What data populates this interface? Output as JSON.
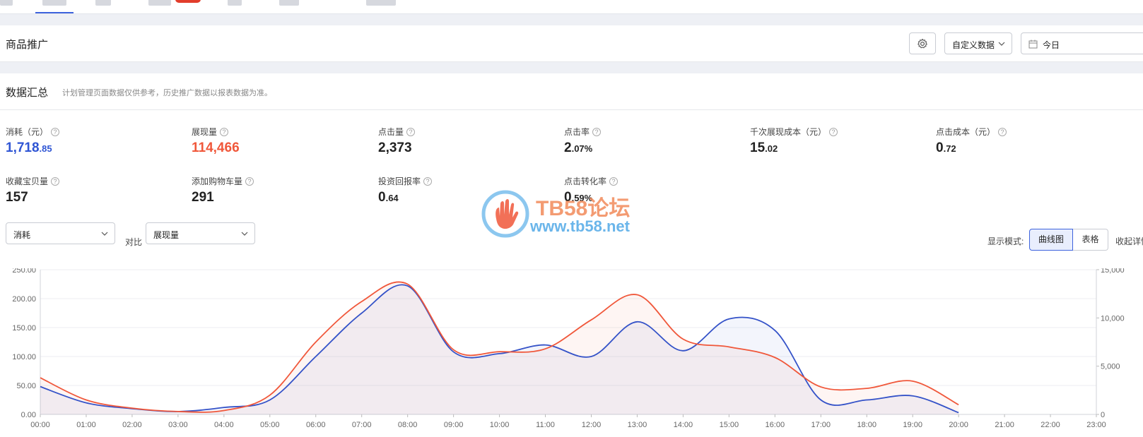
{
  "page": {
    "panel_title": "商品推广",
    "custom_data_label": "自定义数据",
    "date_value": "今日"
  },
  "summary": {
    "title": "数据汇总",
    "note": "计划管理页面数据仅供参考，历史推广数据以报表数据为准。",
    "metrics": [
      {
        "label": "消耗（元）",
        "int": "1,718",
        "dec": ".85",
        "color": "#2f55d4"
      },
      {
        "label": "展现量",
        "int": "114,466",
        "dec": "",
        "color": "#f0573a"
      },
      {
        "label": "点击量",
        "int": "2,373",
        "dec": "",
        "color": "#222222"
      },
      {
        "label": "点击率",
        "int": "2",
        "dec": ".07%",
        "color": "#222222"
      },
      {
        "label": "千次展现成本（元）",
        "int": "15",
        "dec": ".02",
        "color": "#222222"
      },
      {
        "label": "点击成本（元）",
        "int": "0",
        "dec": ".72",
        "color": "#222222"
      },
      {
        "label": "收藏宝贝量",
        "int": "157",
        "dec": "",
        "color": "#222222"
      },
      {
        "label": "添加购物车量",
        "int": "291",
        "dec": "",
        "color": "#222222"
      },
      {
        "label": "投资回报率",
        "int": "0",
        "dec": ".64",
        "color": "#222222"
      },
      {
        "label": "点击转化率",
        "int": "0",
        "dec": ".59%",
        "color": "#222222"
      }
    ]
  },
  "controls": {
    "metric_a": "消耗",
    "compare_label": "对比",
    "metric_b": "展现量",
    "mode_label": "显示模式:",
    "mode_curve": "曲线图",
    "mode_table": "表格",
    "collapse_label": "收起详情"
  },
  "watermark": {
    "brand": "TB58论坛",
    "url": "www.tb58.net"
  },
  "colors": {
    "accent": "#3d63dd",
    "series_blue": "#3452c8",
    "series_red": "#f0573a"
  },
  "chart_data": {
    "type": "line",
    "x": [
      "00:00",
      "01:00",
      "02:00",
      "03:00",
      "04:00",
      "05:00",
      "06:00",
      "07:00",
      "08:00",
      "09:00",
      "10:00",
      "11:00",
      "12:00",
      "13:00",
      "14:00",
      "15:00",
      "16:00",
      "17:00",
      "18:00",
      "19:00",
      "20:00",
      "21:00",
      "22:00",
      "23:00"
    ],
    "left_ticks": [
      "0.00",
      "50.00",
      "100.00",
      "150.00",
      "200.00",
      "250.00"
    ],
    "right_ticks": [
      "0",
      "5,000",
      "10,000",
      "15,000"
    ],
    "ylim_left": [
      0,
      250
    ],
    "ylim_right": [
      0,
      15000
    ],
    "series": [
      {
        "name": "消耗",
        "axis": "left",
        "color": "#3452c8",
        "values": [
          48,
          20,
          10,
          5,
          12,
          25,
          100,
          175,
          222,
          108,
          105,
          120,
          100,
          160,
          110,
          165,
          145,
          25,
          25,
          32,
          3,
          null,
          null,
          null
        ]
      },
      {
        "name": "展现量",
        "axis": "right",
        "color": "#f0573a",
        "values": [
          3800,
          1500,
          650,
          300,
          400,
          2000,
          7500,
          11700,
          13500,
          6700,
          6500,
          6800,
          9800,
          12400,
          7800,
          7000,
          5900,
          2850,
          2700,
          3450,
          1000,
          null,
          null,
          null
        ]
      }
    ],
    "grid": true
  }
}
